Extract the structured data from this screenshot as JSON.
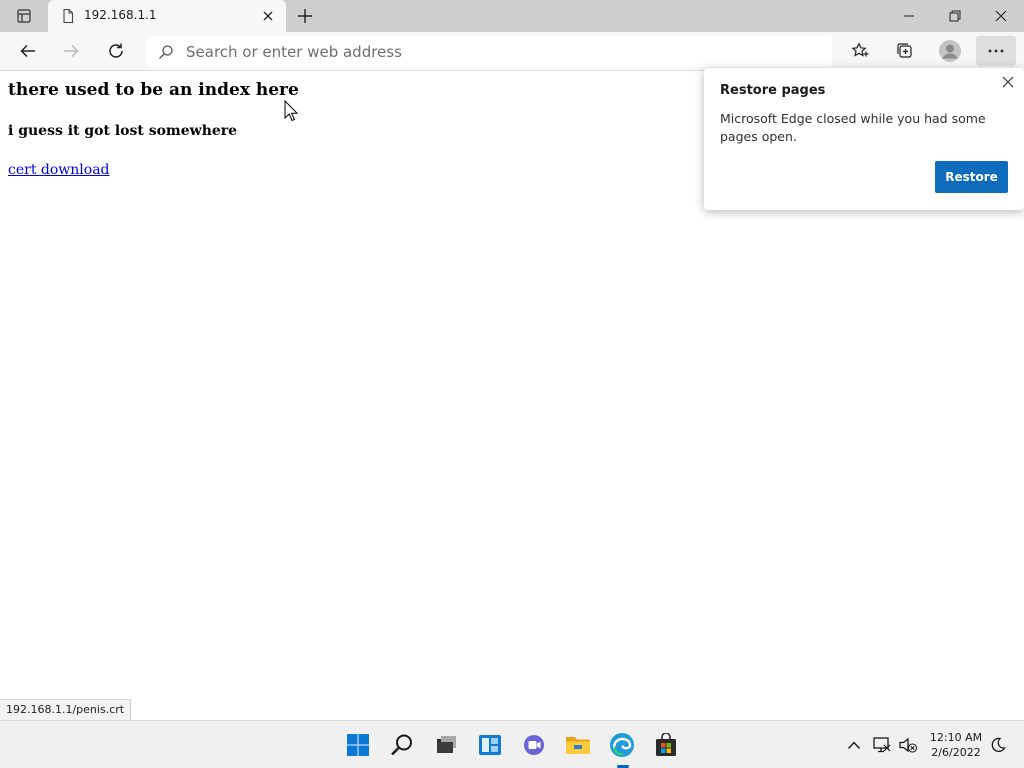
{
  "browser": {
    "tab": {
      "title": "192.168.1.1"
    },
    "address_bar": {
      "value": "",
      "placeholder": "Search or enter web address"
    }
  },
  "page": {
    "heading": "there used to be an index here",
    "subheading": "i guess it got lost somewhere",
    "link_text": "cert download"
  },
  "popup": {
    "title": "Restore pages",
    "message": "Microsoft Edge closed while you had some pages open.",
    "restore_label": "Restore"
  },
  "status_bar": {
    "url": "192.168.1.1/penis.crt"
  },
  "taskbar": {
    "time": "12:10 AM",
    "date": "2/6/2022"
  },
  "colors": {
    "accent": "#0f6cbd",
    "link": "#0000ee",
    "titlebar": "#cfcfcf"
  },
  "icons": {
    "tab_actions": "tab-actions-icon",
    "favicon": "page-icon",
    "back": "arrow-left-icon",
    "forward": "arrow-right-icon",
    "refresh": "refresh-icon",
    "search": "search-icon",
    "favorites": "favorites-star-icon",
    "collections": "collections-icon",
    "profile": "profile-icon",
    "more": "more-icon"
  }
}
